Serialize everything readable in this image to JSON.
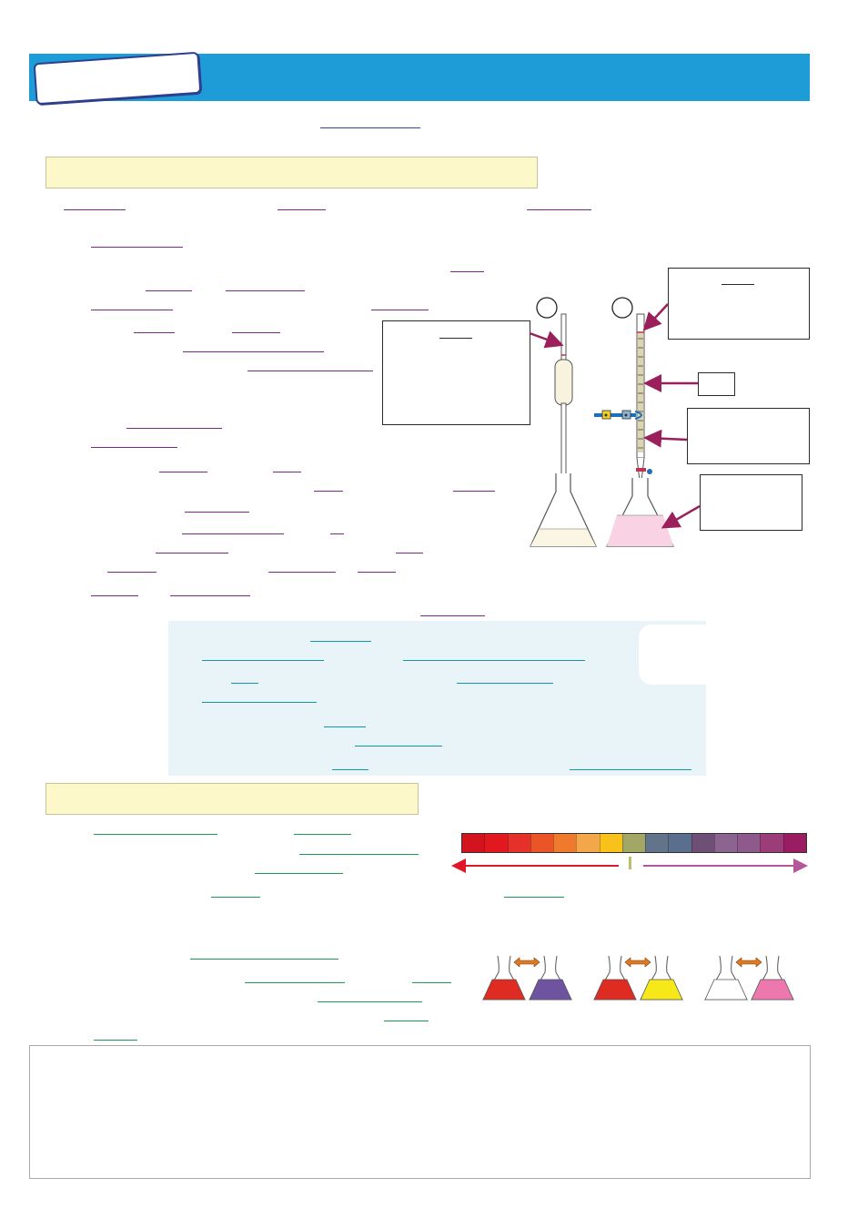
{
  "colors": {
    "header": "#1e9cd7",
    "section_bar": "#fdf8c9",
    "info_box": "#e8f4f7",
    "blank_purple": "#7b2a8a",
    "blank_blue": "#2a4c9c",
    "blank_teal": "#1496a8",
    "blank_green": "#1f9a54",
    "arrow_magenta": "#9b1f5a",
    "acid_red": "#e0162b",
    "alkali_purple": "#b3569c",
    "double_arrow": "#e07a1f"
  },
  "scale_colors": [
    "#d3141f",
    "#e1181f",
    "#e6302a",
    "#eb5427",
    "#ef7a2e",
    "#f4a64a",
    "#f9c21a",
    "#a2a766",
    "#627489",
    "#5a6f8e",
    "#6e4f75",
    "#8b6590",
    "#8e5a8c",
    "#9a3d78",
    "#9a1d62"
  ],
  "indicator_pairs": [
    {
      "left": "#df2c22",
      "right": "#6e53a0"
    },
    {
      "left": "#df2c22",
      "right": "#f7e81a"
    },
    {
      "left": "#ffffff",
      "right": "#ec78ad"
    }
  ],
  "icons": [
    "pipette-icon",
    "burette-icon",
    "conical-flask-icon",
    "clamp-icon",
    "double-arrow-icon",
    "label-arrow-icon"
  ]
}
